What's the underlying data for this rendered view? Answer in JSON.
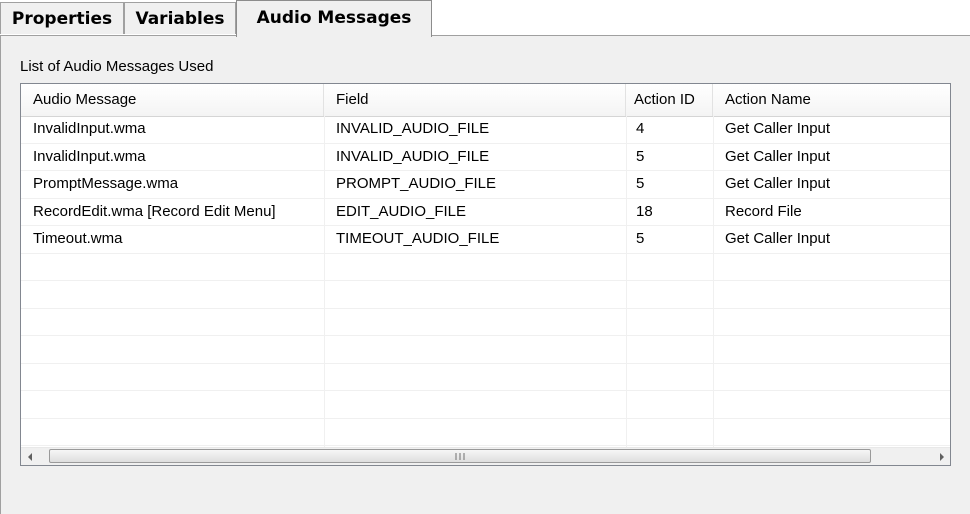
{
  "tabs": [
    {
      "label": "Properties",
      "active": false
    },
    {
      "label": "Variables",
      "active": false
    },
    {
      "label": "Audio Messages",
      "active": true
    }
  ],
  "group_label": "List of Audio Messages Used",
  "table": {
    "columns": [
      "Audio Message",
      "Field",
      "Action ID",
      "Action Name"
    ],
    "rows": [
      [
        "InvalidInput.wma",
        "INVALID_AUDIO_FILE",
        "4",
        "Get Caller Input"
      ],
      [
        "InvalidInput.wma",
        "INVALID_AUDIO_FILE",
        "5",
        "Get Caller Input"
      ],
      [
        "PromptMessage.wma",
        "PROMPT_AUDIO_FILE",
        "5",
        "Get Caller Input"
      ],
      [
        "RecordEdit.wma [Record Edit Menu]",
        "EDIT_AUDIO_FILE",
        "18",
        "Record File"
      ],
      [
        "Timeout.wma",
        "TIMEOUT_AUDIO_FILE",
        "5",
        "Get Caller Input"
      ],
      [
        "",
        "",
        "",
        ""
      ],
      [
        "",
        "",
        "",
        ""
      ],
      [
        "",
        "",
        "",
        ""
      ],
      [
        "",
        "",
        "",
        ""
      ],
      [
        "",
        "",
        "",
        ""
      ],
      [
        "",
        "",
        "",
        ""
      ],
      [
        "",
        "",
        "",
        ""
      ],
      [
        "",
        "",
        "",
        ""
      ]
    ]
  },
  "icons": {
    "scroll_left": "chevron-left-icon",
    "scroll_right": "chevron-right-icon"
  },
  "colors": {
    "window_bg": "#f0f0f0",
    "list_bg": "#ffffff",
    "border": "#828790"
  }
}
